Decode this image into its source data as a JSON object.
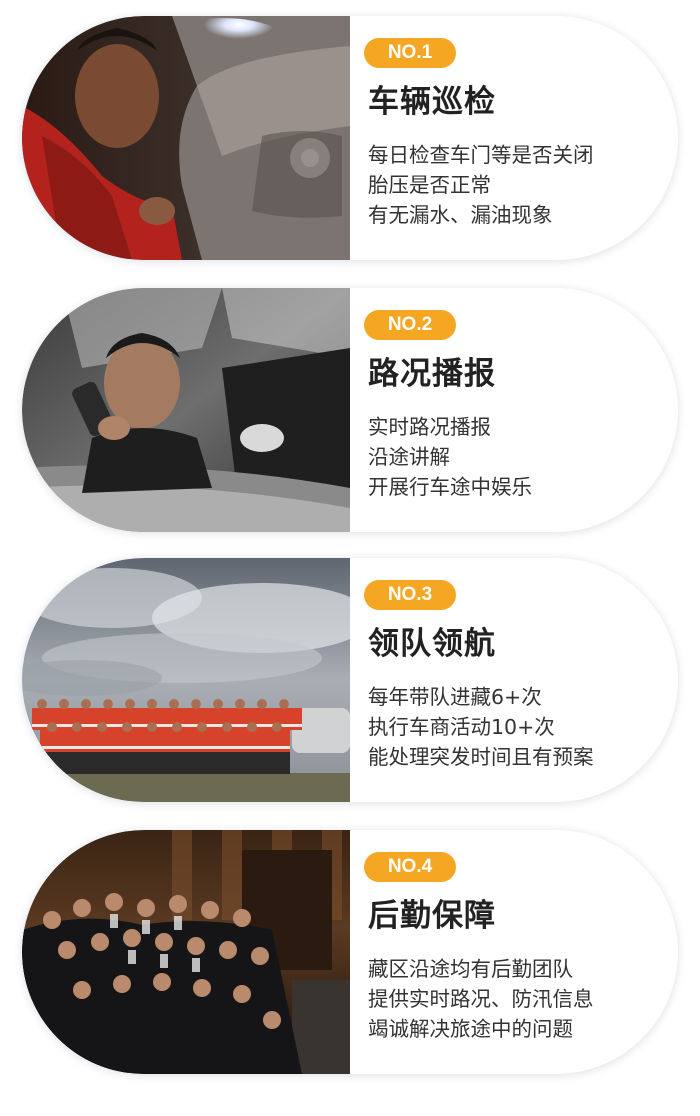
{
  "cards": [
    {
      "badge": "NO.1",
      "title": "车辆巡检",
      "lines": [
        "每日检查车门等是否关闭",
        "胎压是否正常",
        "有无漏水、漏油现象"
      ],
      "photo": "mechanic-inspecting-car-photo"
    },
    {
      "badge": "NO.2",
      "title": "路况播报",
      "lines": [
        "实时路况播报",
        "沿途讲解",
        "开展行车途中娱乐"
      ],
      "photo": "driver-with-radio-photo"
    },
    {
      "badge": "NO.3",
      "title": "领队领航",
      "lines": [
        "每年带队进藏6+次",
        "执行车商活动10+次",
        "能处理突发时间且有预案"
      ],
      "photo": "team-group-outdoor-photo"
    },
    {
      "badge": "NO.4",
      "title": "后勤保障",
      "lines": [
        "藏区沿途均有后勤团队",
        "提供实时路况、防汛信息",
        "竭诚解决旅途中的问题"
      ],
      "photo": "staff-group-indoor-photo"
    }
  ],
  "colors": {
    "badge": "#f5a623",
    "title": "#222222",
    "text": "#333333"
  }
}
